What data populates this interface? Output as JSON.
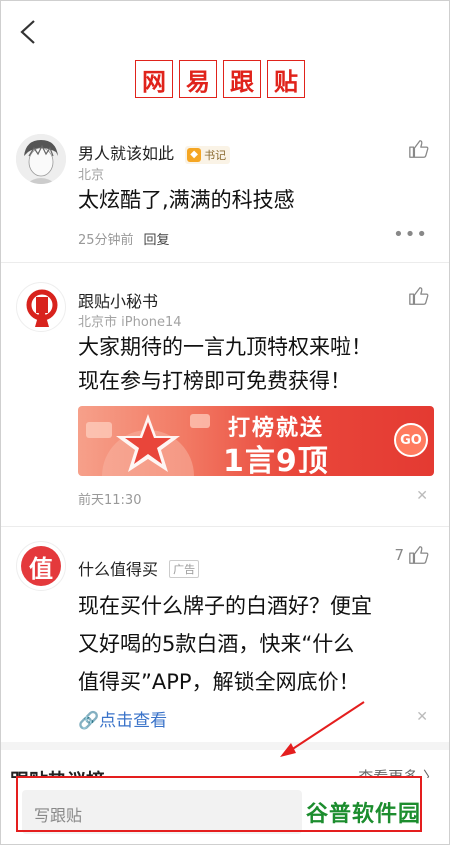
{
  "header": {
    "logo_chars": [
      "网",
      "易",
      "跟",
      "贴"
    ]
  },
  "comments": [
    {
      "username": "男人就该如此",
      "badge": "书记",
      "location": "北京",
      "text": "太炫酷了,满满的科技感",
      "time": "25分钟前",
      "reply": "回复"
    },
    {
      "username": "跟贴小秘书",
      "location": "北京市 iPhone14",
      "text_line1": "大家期待的一言九顶特权来啦！",
      "text_line2": "现在参与打榜即可免费获得！",
      "banner_line1": "打榜就送",
      "banner_line2": "1言9顶",
      "banner_go": "GO",
      "time": "前天11:30"
    },
    {
      "username": "什么值得买",
      "ad_tag": "广告",
      "avatar_char": "值",
      "likes": "7",
      "text_line1": "现在买什么牌子的白酒好？便宜",
      "text_line2": "又好喝的5款白酒，快来“什么",
      "text_line3": "值得买”APP，解锁全网底价！",
      "link": "点击查看"
    }
  ],
  "hot_section": {
    "title": "跟贴热议榜",
    "see_more": "查看更多 〉"
  },
  "input": {
    "placeholder": "写跟贴"
  },
  "watermark": {
    "part1": "谷普",
    "part2": "软件园"
  },
  "colors": {
    "brand_red": "#e0231b",
    "link_blue": "#3a73c9",
    "annotation_red": "#e41e1e"
  }
}
